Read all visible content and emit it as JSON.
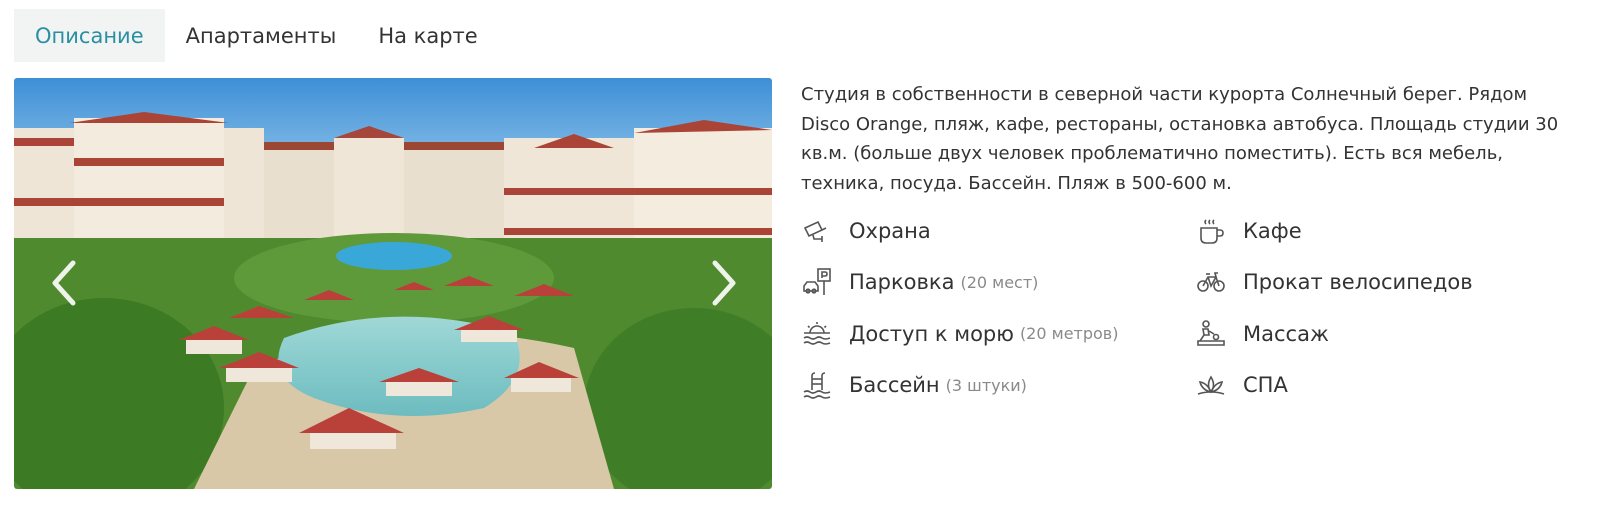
{
  "tabs": [
    {
      "label": "Описание",
      "active": true
    },
    {
      "label": "Апартаменты",
      "active": false
    },
    {
      "label": "На карте",
      "active": false
    }
  ],
  "description": "Студия в собственности в северной части курорта Солнечный берег. Рядом Disco Orange, пляж, кафе, рестораны, остановка автобуса. Площадь студии 30 кв.м. (больше двух человек проблематично поместить). Есть вся мебель, техника, посуда. Бассейн. Пляж в 500-600 м.",
  "features_left": [
    {
      "icon": "security-camera-icon",
      "label": "Охрана",
      "note": ""
    },
    {
      "icon": "parking-icon",
      "label": "Парковка",
      "note": "(20 мест)"
    },
    {
      "icon": "sea-icon",
      "label": "Доступ к морю",
      "note": "(20 метров)"
    },
    {
      "icon": "pool-ladder-icon",
      "label": "Бассейн",
      "note": "(3 штуки)"
    }
  ],
  "features_right": [
    {
      "icon": "coffee-cup-icon",
      "label": "Кафе",
      "note": ""
    },
    {
      "icon": "bicycle-icon",
      "label": "Прокат велосипедов",
      "note": ""
    },
    {
      "icon": "massage-icon",
      "label": "Массаж",
      "note": ""
    },
    {
      "icon": "lotus-icon",
      "label": "СПА",
      "note": ""
    }
  ],
  "colors": {
    "accent": "#2a8fa3",
    "active_tab_bg": "#f2f4f3",
    "muted": "#8a8a8a"
  }
}
